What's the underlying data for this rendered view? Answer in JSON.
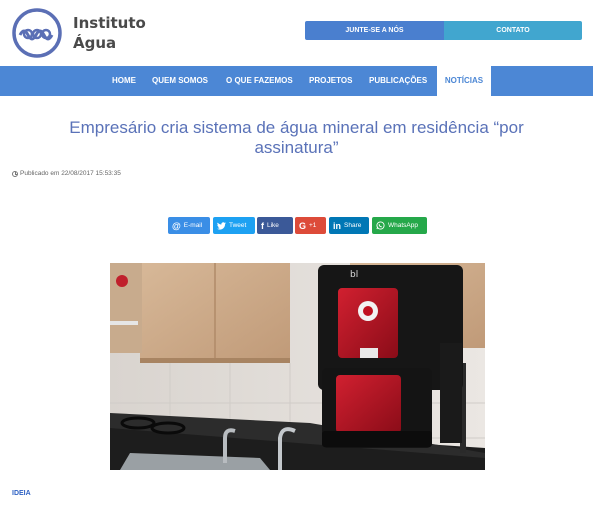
{
  "header": {
    "logo_line1": "Instituto",
    "logo_line2": "Água",
    "join_label": "JUNTE-SE A NÓS",
    "contact_label": "CONTATO"
  },
  "nav": {
    "items": [
      {
        "label": "HOME"
      },
      {
        "label": "QUEM SOMOS"
      },
      {
        "label": "O QUE FAZEMOS"
      },
      {
        "label": "PROJETOS"
      },
      {
        "label": "PUBLICAÇÕES"
      },
      {
        "label": "NOTÍCIAS"
      }
    ],
    "active": "NOTÍCIAS"
  },
  "article": {
    "title": "Empresário cria sistema de água mineral em residência “por assinatura”",
    "published": "Publicado em 22/08/2017 15:53:35",
    "device_brand": "bl"
  },
  "share": {
    "email": "E-mail",
    "tweet": "Tweet",
    "like": "Like",
    "plus": "+1",
    "share": "Share",
    "whatsapp": "WhatsApp"
  },
  "tag": "IDEIA",
  "colors": {
    "nav_bg": "#4c87d5",
    "join_bg": "#4a7fcf",
    "contact_bg": "#41a6cf",
    "title": "#5a72b8",
    "device_red": "#b01020"
  },
  "icons": [
    "logo-waves-icon",
    "clock-icon",
    "email-icon",
    "twitter-icon",
    "facebook-icon",
    "googleplus-icon",
    "linkedin-icon",
    "whatsapp-icon"
  ]
}
